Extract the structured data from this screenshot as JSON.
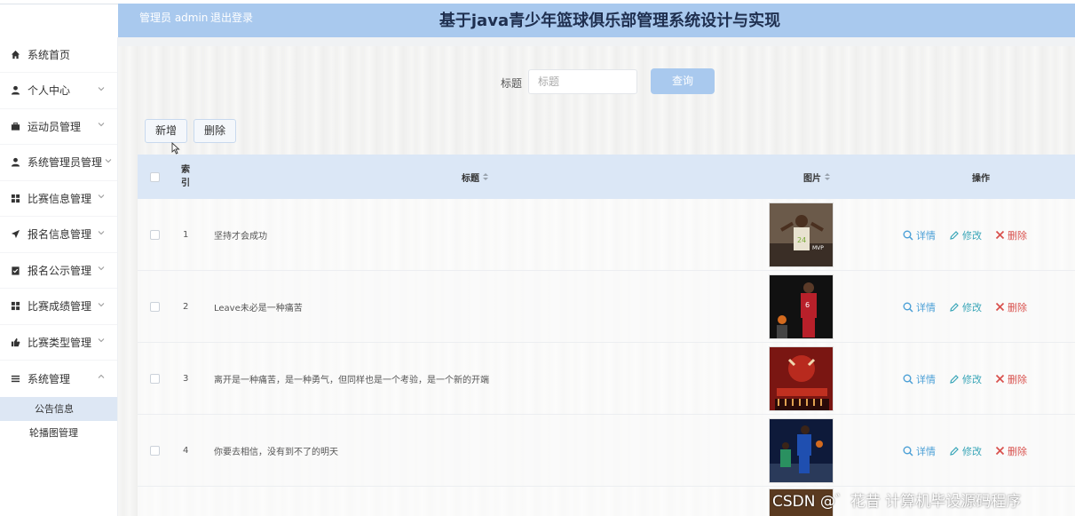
{
  "header": {
    "user_label": "管理员 admin",
    "logout_label": "退出登录",
    "title": "基于java青少年篮球俱乐部管理系统设计与实现"
  },
  "sidebar": {
    "items": [
      {
        "label": "系统首页",
        "icon": "home-icon"
      },
      {
        "label": "个人中心",
        "icon": "user-icon"
      },
      {
        "label": "运动员管理",
        "icon": "briefcase-icon"
      },
      {
        "label": "系统管理员管理",
        "icon": "user-icon"
      },
      {
        "label": "比赛信息管理",
        "icon": "grid-icon"
      },
      {
        "label": "报名信息管理",
        "icon": "send-icon"
      },
      {
        "label": "报名公示管理",
        "icon": "clipboard-icon"
      },
      {
        "label": "比赛成绩管理",
        "icon": "grid-icon"
      },
      {
        "label": "比赛类型管理",
        "icon": "thumb-icon"
      },
      {
        "label": "系统管理",
        "icon": "list-icon"
      }
    ],
    "subitems": [
      {
        "label": "公告信息",
        "active": true
      },
      {
        "label": "轮播图管理",
        "active": false
      }
    ]
  },
  "search": {
    "label": "标题",
    "placeholder": "标题",
    "button": "查询"
  },
  "toolbar": {
    "add_label": "新增",
    "delete_label": "删除"
  },
  "table": {
    "columns": {
      "index": "索引",
      "title": "标题",
      "image": "图片",
      "actions": "操作"
    },
    "rows": [
      {
        "index": "1",
        "title": "坚持才会成功"
      },
      {
        "index": "2",
        "title": "Leave未必是一种痛苦"
      },
      {
        "index": "3",
        "title": "离开是一种痛苦，是一种勇气，但同样也是一个考验，是一个新的开端"
      },
      {
        "index": "4",
        "title": "你要去相信，没有到不了的明天"
      }
    ],
    "action_labels": {
      "detail": "详情",
      "edit": "修改",
      "delete": "删除"
    }
  },
  "watermark": "CSDN @゛花昔  计算机毕设源码程序",
  "colors": {
    "header": "#a9c9ee",
    "table_header": "#dbe7f6",
    "detail": "#4a9fd6",
    "edit": "#3aa6b8",
    "delete": "#d9534f"
  }
}
